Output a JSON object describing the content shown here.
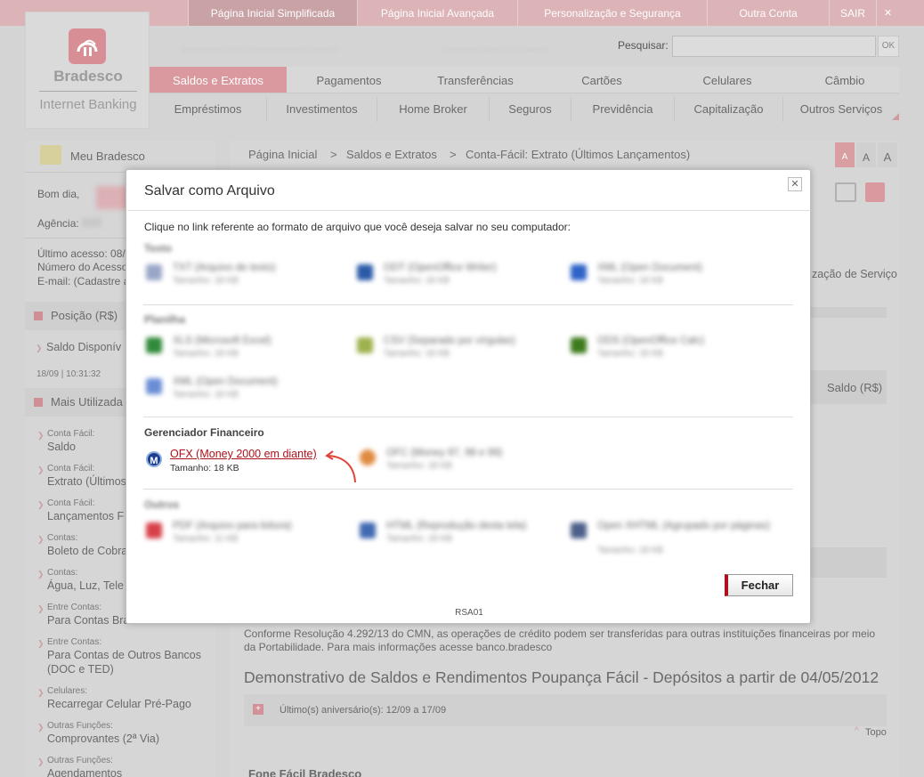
{
  "topnav": {
    "items": [
      "Página Inicial Simplificada",
      "Página Inicial Avançada",
      "Personalização e Segurança",
      "Outra Conta"
    ],
    "logout": "SAIR",
    "close": "✕"
  },
  "logo": {
    "name": "Bradesco",
    "subtitle": "Internet Banking"
  },
  "search": {
    "label": "Pesquisar:",
    "button": "OK"
  },
  "mainnav": {
    "row1": [
      "Saldos e Extratos",
      "Pagamentos",
      "Transferências",
      "Cartões",
      "Celulares",
      "Câmbio"
    ],
    "row2": [
      "Empréstimos",
      "Investimentos",
      "Home Broker",
      "Seguros",
      "Previdência",
      "Capitalização",
      "Outros Serviços"
    ]
  },
  "left": {
    "meu_bradesco": "Meu Bradesco",
    "greeting": "Bom dia,",
    "agencia": "Agência:",
    "ultimo_acesso": "Último acesso: 08/",
    "numero_acesso": "Número do Acesso",
    "email": "E-mail: (Cadastre a",
    "posicao_title": "Posição (R$)",
    "saldo_disponivel": "Saldo Disponív",
    "saldo_time": "18/09 | 10:31:32",
    "mais_utilizadas_title": "Mais Utilizada",
    "links": [
      {
        "cat": "Conta Fácil:",
        "label": "Saldo"
      },
      {
        "cat": "Conta Fácil:",
        "label": "Extrato (Últimos"
      },
      {
        "cat": "Conta Fácil:",
        "label": "Lançamentos F"
      },
      {
        "cat": "Contas:",
        "label": "Boleto de Cobra"
      },
      {
        "cat": "Contas:",
        "label": "Água, Luz, Tele"
      },
      {
        "cat": "Entre Contas:",
        "label": "Para Contas Bra"
      },
      {
        "cat": "Entre Contas:",
        "label": "Para Contas de Outros Bancos"
      },
      {
        "cat": "Celulares:",
        "label": "Recarregar Celular Pré-Pago"
      },
      {
        "cat": "Outras Funções:",
        "label": "Comprovantes (2ª Via)"
      },
      {
        "cat": "Outras Funções:",
        "label": "Agendamentos"
      }
    ],
    "doc_ted": "(DOC e TED)"
  },
  "breadcrumb": [
    "Página Inicial",
    "Saldos e Extratos",
    "Conta-Fácil: Extrato (Últimos Lançamentos)"
  ],
  "fontsize": [
    "A",
    "A",
    "A"
  ],
  "main": {
    "servico": "zação de Serviço",
    "saldo_col": "Saldo (R$)",
    "resolution": "Conforme Resolução 4.292/13 do CMN, as operações de crédito podem ser transferidas para outras instituições financeiras por meio da Portabilidade. Para mais informações acesse banco.bradesco",
    "demonstrativo": "Demonstrativo de Saldos e Rendimentos Poupança Fácil - Depósitos a partir de 04/05/2012",
    "aniversario": "Último(s) aniversário(s): 12/09 a 17/09",
    "topo": "Topo",
    "fone_facil": "Fone Fácil Bradesco"
  },
  "modal": {
    "title": "Salvar como Arquivo",
    "close": "✕",
    "instruction": "Clique no link referente ao formato de arquivo que você deseja salvar no seu computador:",
    "sections": {
      "texto": "Texto",
      "planilha": "Planilha",
      "gerenciador": "Gerenciador Financeiro",
      "outros": "Outros"
    },
    "files": {
      "txt": {
        "name": "TXT (Arquivo de texto)",
        "size": "Tamanho: 18 KB"
      },
      "odt": {
        "name": "ODT (OpenOffice Writer)",
        "size": "Tamanho: 18 KB"
      },
      "xml": {
        "name": "XML (Open Document)",
        "size": "Tamanho: 18 KB"
      },
      "xls": {
        "name": "XLS (Microsoft Excel)",
        "size": "Tamanho: 18 KB"
      },
      "csv": {
        "name": "CSV (Separado por vírgulas)",
        "size": "Tamanho: 18 KB"
      },
      "ods": {
        "name": "ODS (OpenOffice Calc)",
        "size": "Tamanho: 18 KB"
      },
      "xml2": {
        "name": "XML (Open Document)",
        "size": "Tamanho: 18 KB"
      },
      "ofx": {
        "name": "OFX (Money 2000 em diante)",
        "size": "Tamanho: 18 KB"
      },
      "ofc": {
        "name": "OFC (Money 97, 98 e 99)",
        "size": "Tamanho: 18 KB"
      },
      "pdf": {
        "name": "PDF (Arquivo para leitura)",
        "size": "Tamanho: 11 KB"
      },
      "html": {
        "name": "HTML (Reprodução desta tela)",
        "size": "Tamanho: 18 KB"
      },
      "openxhtml": {
        "name": "Open XHTML (Agrupado por páginas)",
        "size": "Tamanho: 18 KB"
      }
    },
    "fechar": "Fechar",
    "code": "RSA01"
  },
  "colors": {
    "brand": "#cc092f",
    "link": "#b0101a",
    "arrow": "#e0453a"
  }
}
